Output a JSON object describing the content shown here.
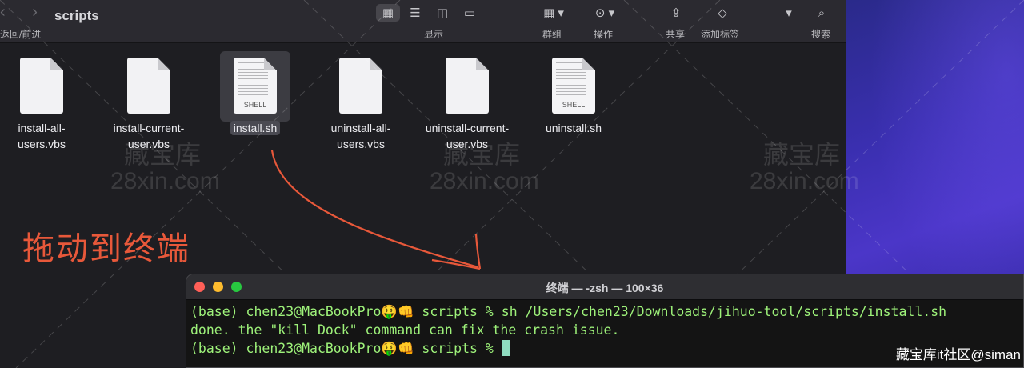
{
  "finder": {
    "title": "scripts",
    "nav_label": "返回/前进",
    "toolbar": {
      "view_label": "显示",
      "group_label": "群组",
      "action_label": "操作",
      "share_label": "共享",
      "tag_label": "添加标签",
      "search_label": "搜索"
    },
    "files": [
      {
        "name_line1": "install-all-",
        "name_line2": "users.vbs",
        "type": "doc"
      },
      {
        "name_line1": "install-current-",
        "name_line2": "user.vbs",
        "type": "doc"
      },
      {
        "name_line1": "install.sh",
        "name_line2": "",
        "type": "shell",
        "shell_tag": "SHELL",
        "selected": true
      },
      {
        "name_line1": "uninstall-all-",
        "name_line2": "users.vbs",
        "type": "doc"
      },
      {
        "name_line1": "uninstall-current-",
        "name_line2": "user.vbs",
        "type": "doc"
      },
      {
        "name_line1": "uninstall.sh",
        "name_line2": "",
        "type": "shell",
        "shell_tag": "SHELL"
      }
    ]
  },
  "annotation": {
    "text": "拖动到终端",
    "color": "#e8583a"
  },
  "watermark": {
    "cn": "藏宝库",
    "en": "28xin.com"
  },
  "terminal": {
    "title": "终端 — -zsh — 100×36",
    "lines": [
      "(base) chen23@MacBookPro🤑👊 scripts % sh /Users/chen23/Downloads/jihuo-tool/scripts/install.sh",
      "done. the \"kill Dock\" command can fix the crash issue.",
      "(base) chen23@MacBookPro🤑👊 scripts % "
    ],
    "text_color": "#9ef27a"
  },
  "credit": "藏宝库it社区@siman"
}
